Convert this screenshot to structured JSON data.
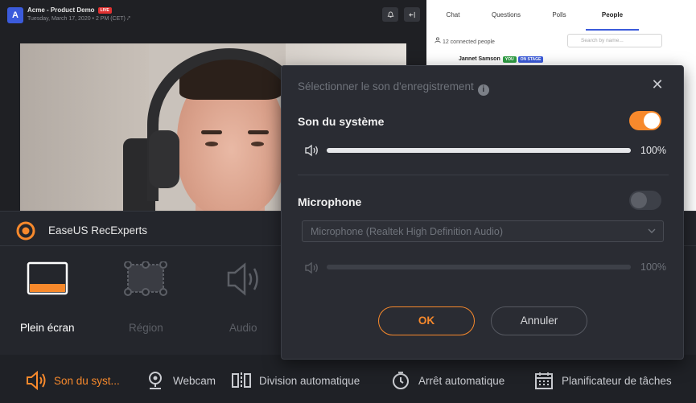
{
  "meeting": {
    "title": "Acme - Product Demo",
    "live_badge": "LIVE",
    "subtitle": "Tuesday, March 17, 2020 • 2 PM (CET) ⤤",
    "tabs": [
      "Chat",
      "Questions",
      "Polls",
      "People"
    ],
    "active_tab": "People",
    "connected": "12 connected people",
    "search_placeholder": "Search by name...",
    "person_name": "Jannet Samson",
    "badge_you": "YOU",
    "badge_stage": "ON STAGE"
  },
  "recorder": {
    "app_name": "EaseUS RecExperts",
    "modes": [
      {
        "label": "Plein écran",
        "active": true
      },
      {
        "label": "Région",
        "active": false
      },
      {
        "label": "Audio",
        "active": false
      }
    ],
    "bottom_bar": [
      {
        "label": "Son du syst...",
        "icon": "speaker-icon",
        "highlight": true
      },
      {
        "label": "Webcam",
        "icon": "webcam-icon",
        "highlight": false
      },
      {
        "label": "Division automatique",
        "icon": "split-icon",
        "highlight": false
      },
      {
        "label": "Arrêt automatique",
        "icon": "stopwatch-icon",
        "highlight": false
      },
      {
        "label": "Planificateur de tâches",
        "icon": "calendar-icon",
        "highlight": false
      }
    ]
  },
  "popup": {
    "title": "Sélectionner le son d'enregistrement",
    "info_glyph": "i",
    "close_glyph": "✕",
    "system_sound": {
      "label": "Son du système",
      "enabled": true,
      "volume": 100,
      "volume_text": "100%"
    },
    "microphone": {
      "label": "Microphone",
      "enabled": false,
      "device": "Microphone (Realtek High Definition Audio)",
      "volume": 100,
      "volume_text": "100%"
    },
    "ok_label": "OK",
    "cancel_label": "Annuler"
  },
  "colors": {
    "accent": "#f7892c",
    "disabled": "#6f737b"
  }
}
